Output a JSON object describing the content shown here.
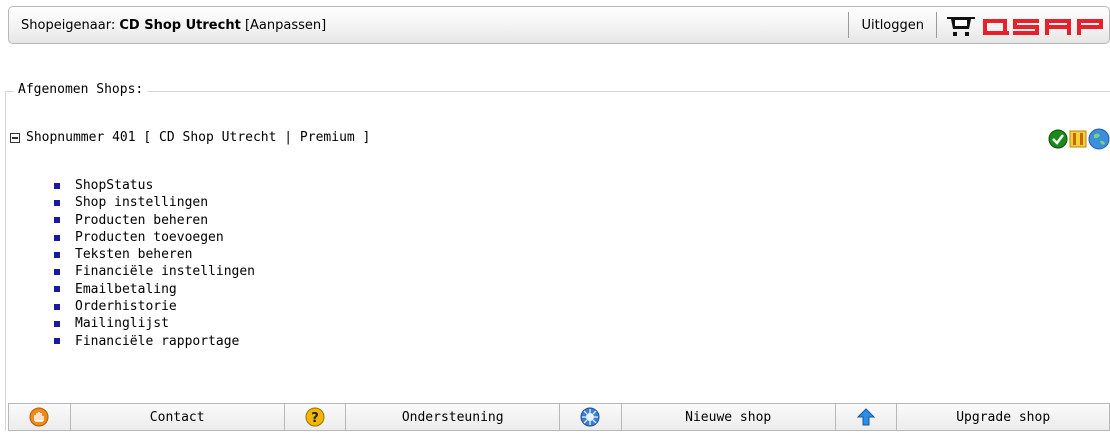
{
  "header": {
    "owner_prefix": "Shopeigenaar:",
    "shop_name": "CD Shop Utrecht",
    "edit_label": "[Aanpassen]",
    "logout_label": "Uitloggen",
    "logo_text": "QSAP",
    "accent_color": "#e8202a"
  },
  "section": {
    "legend": "Afgenomen Shops:",
    "shop_line": "Shopnummer 401 [ CD Shop Utrecht | Premium ]",
    "status_icons": [
      "check-icon",
      "pause-icon",
      "globe-icon"
    ]
  },
  "menu": {
    "items": [
      {
        "label": "ShopStatus"
      },
      {
        "label": "Shop instellingen"
      },
      {
        "label": "Producten beheren"
      },
      {
        "label": "Producten toevoegen"
      },
      {
        "label": "Teksten beheren"
      },
      {
        "label": "Financiële instellingen"
      },
      {
        "label": "Emailbetaling"
      },
      {
        "label": "Orderhistorie"
      },
      {
        "label": "Mailinglijst"
      },
      {
        "label": "Financiële rapportage"
      }
    ]
  },
  "footer": {
    "buttons": [
      {
        "icon": "hand-icon",
        "label": "Contact"
      },
      {
        "icon": "question-icon",
        "label": "Ondersteuning"
      },
      {
        "icon": "new-shop-icon",
        "label": "Nieuwe shop"
      },
      {
        "icon": "upgrade-arrow-icon",
        "label": "Upgrade shop"
      }
    ]
  }
}
